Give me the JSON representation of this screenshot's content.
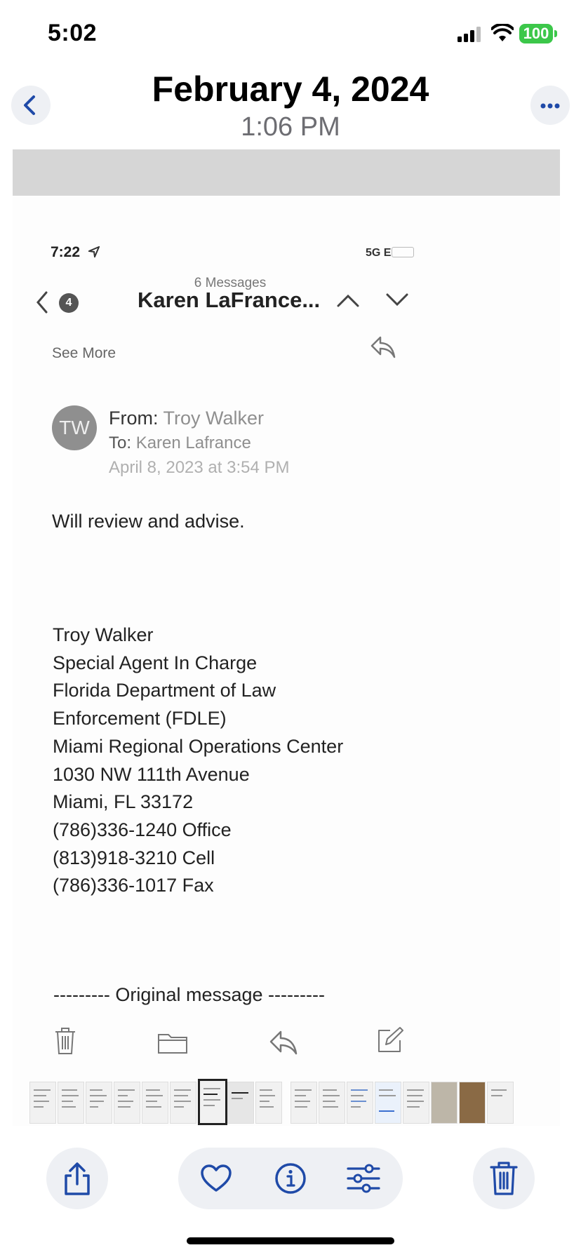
{
  "status_bar": {
    "time": "5:02",
    "battery": "100"
  },
  "header": {
    "date": "February 4, 2024",
    "time": "1:06 PM"
  },
  "photo": {
    "status_time": "7:22",
    "network": "5G E",
    "message_count": "6 Messages",
    "thread_title": "Karen LaFrance...",
    "unread_badge": "4",
    "see_more": "See More",
    "avatar_initials": "TW",
    "from_label": "From:",
    "from_name": "Troy Walker",
    "to_label": "To:",
    "to_name": "Karen Lafrance",
    "sent_date": "April 8, 2023 at 3:54 PM",
    "body_first_line": "Will review and advise.",
    "signature": [
      "Troy Walker",
      "Special Agent In Charge",
      "Florida Department of Law",
      "Enforcement (FDLE)",
      "Miami Regional Operations Center",
      "1030 NW 111th Avenue",
      "Miami, FL 33172",
      "(786)336-1240 Office",
      "(813)918-3210 Cell",
      "(786)336-1017 Fax"
    ],
    "original_message": "--------- Original message ---------"
  },
  "colors": {
    "accent": "#1f4aa8",
    "battery": "#3cc74a",
    "button_bg": "#eef0f4"
  },
  "icons": {
    "back": "chevron-left-icon",
    "more": "ellipsis-icon",
    "share": "share-icon",
    "favorite": "heart-icon",
    "info": "info-icon",
    "adjust": "sliders-icon",
    "delete": "trash-icon"
  }
}
